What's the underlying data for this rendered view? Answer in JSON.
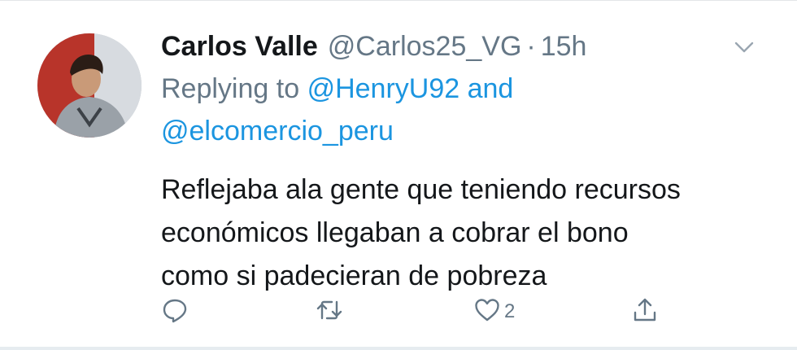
{
  "tweet": {
    "display_name": "Carlos Valle",
    "handle": "@Carlos25_VG",
    "separator": "·",
    "time": "15h",
    "reply_prefix": "Replying to",
    "reply_mention_1": "@HenryU92",
    "reply_and": "and",
    "reply_mention_2": "@elcomercio_peru",
    "text": "Reflejaba ala gente que teniendo recursos\neconómicos llegaban a cobrar el bono\ncomo si padecieran de pobreza",
    "like_count": "2"
  },
  "icons": {
    "menu": "chevron-down-icon",
    "reply": "reply-icon",
    "retweet": "retweet-icon",
    "like": "heart-icon",
    "share": "share-icon"
  },
  "colors": {
    "name": "#14171a",
    "secondary": "#657786",
    "link": "#1b95e0"
  }
}
